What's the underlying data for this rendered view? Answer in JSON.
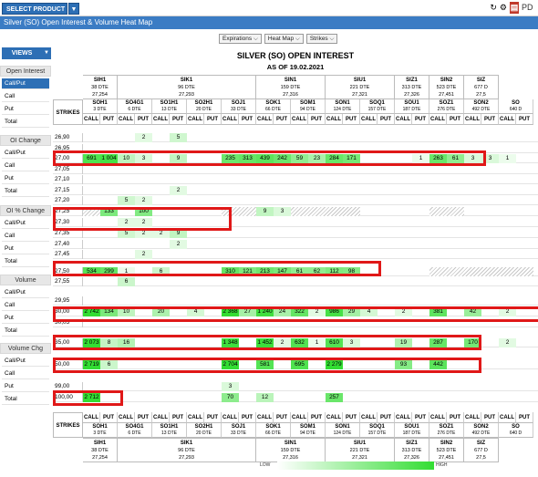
{
  "topbar": {
    "select_product": "SELECT PRODUCT",
    "pdf_label": "PD"
  },
  "title": "Silver (SO) Open Interest & Volume Heat Map",
  "controls": [
    "Expirations ⌵",
    "Heat Map ⌵",
    "Strikes ⌵"
  ],
  "sidebar": {
    "views": "VIEWS",
    "groups": [
      {
        "header": "Open Interest",
        "items": [
          "Call/Put",
          "Call",
          "Put",
          "Total"
        ],
        "selected": 0
      },
      {
        "header": "OI Change",
        "items": [
          "Call/Put",
          "Call",
          "Put",
          "Total"
        ]
      },
      {
        "header": "OI % Change",
        "items": [
          "Call/Put",
          "Call",
          "Put",
          "Total"
        ]
      },
      {
        "header": "Volume",
        "items": [
          "Call/Put",
          "Call",
          "Put",
          "Total"
        ]
      },
      {
        "header": "Volume Chg",
        "items": [
          "Call/Put",
          "Call",
          "Put",
          "Total"
        ]
      }
    ]
  },
  "heatmap": {
    "title": "SILVER (SO) OPEN INTEREST",
    "date": "AS OF 19.02.2021",
    "strikes_label": "STRIKES",
    "call": "CALL",
    "put": "PUT",
    "futures": [
      {
        "name": "SIH1",
        "dte": "38 DTE",
        "oi": "27,254"
      },
      {
        "name": "SIK1",
        "dte": "96 DTE",
        "oi": "27,293"
      },
      {
        "name": "SIN1",
        "dte": "159 DTE",
        "oi": "27,316"
      },
      {
        "name": "SIU1",
        "dte": "221 DTE",
        "oi": "27,321"
      },
      {
        "name": "SIZ1",
        "dte": "313 DTE",
        "oi": "27,326"
      },
      {
        "name": "SIN2",
        "dte": "523 DTE",
        "oi": "27,451"
      },
      {
        "name": "SIZ",
        "dte": "677 D",
        "oi": "27,5"
      }
    ],
    "options": [
      {
        "name": "SOH1",
        "dte": "3 DTE"
      },
      {
        "name": "SO4G1",
        "dte": "6 DTE"
      },
      {
        "name": "SO1H1",
        "dte": "13 DTE"
      },
      {
        "name": "SO2H1",
        "dte": "20 DTE"
      },
      {
        "name": "SOJ1",
        "dte": "33 DTE"
      },
      {
        "name": "SOK1",
        "dte": "66 DTE"
      },
      {
        "name": "SOM1",
        "dte": "94 DTE"
      },
      {
        "name": "SON1",
        "dte": "124 DTE"
      },
      {
        "name": "SOQ1",
        "dte": "157 DTE"
      },
      {
        "name": "SOU1",
        "dte": "187 DTE"
      },
      {
        "name": "SOZ1",
        "dte": "276 DTE"
      },
      {
        "name": "SON2",
        "dte": "492 DTE"
      },
      {
        "name": "SO",
        "dte": "640 D"
      }
    ],
    "rows": [
      {
        "strike": "26,90",
        "cells": [
          "",
          "",
          "",
          "2",
          "",
          "5",
          "",
          "",
          "",
          "",
          "",
          "",
          "",
          "",
          "",
          "",
          "",
          "",
          "",
          "",
          "",
          "",
          "",
          "",
          "",
          ""
        ]
      },
      {
        "strike": "26,95",
        "cells": []
      },
      {
        "strike": "27,00",
        "cells": [
          "691",
          "1 004",
          "10",
          "3",
          "",
          "9",
          "",
          "",
          "235",
          "313",
          "439",
          "242",
          "59",
          "23",
          "284",
          "171",
          "",
          "",
          "",
          "1",
          "263",
          "61",
          "3",
          "3",
          "1",
          ""
        ]
      },
      {
        "strike": "27,05",
        "cells": []
      },
      {
        "strike": "27,10",
        "cells": []
      },
      {
        "strike": "27,15",
        "cells": [
          "",
          "",
          "",
          "",
          "",
          "2",
          "",
          "",
          "",
          "",
          "",
          "",
          "",
          "",
          "",
          "",
          "",
          "",
          "",
          "",
          "",
          "",
          "",
          "",
          "",
          ""
        ]
      },
      {
        "strike": "27,20",
        "cells": [
          "",
          "",
          "5",
          "2",
          "",
          "",
          "",
          "",
          "",
          "",
          "",
          "",
          "",
          "",
          "",
          "",
          "",
          "",
          "",
          "",
          "",
          "",
          "",
          "",
          "",
          ""
        ]
      },
      {
        "strike": "27,25",
        "cells": [
          "234",
          "133",
          "",
          "100",
          "",
          "",
          "",
          "",
          "415",
          "38",
          "9",
          "3",
          "41",
          "41",
          "2",
          "2",
          "",
          "",
          "",
          "",
          "1",
          "1",
          "",
          "",
          "",
          ""
        ]
      },
      {
        "strike": "27,30",
        "cells": [
          "",
          "",
          "2",
          "2",
          "",
          "",
          "",
          "",
          "",
          "",
          "",
          "",
          "",
          "",
          "",
          "",
          "",
          "",
          "",
          "",
          "",
          "",
          "",
          "",
          "",
          ""
        ]
      },
      {
        "strike": "27,35",
        "cells": [
          "",
          "",
          "5",
          "2",
          "2",
          "9",
          "",
          "",
          "",
          "",
          "",
          "",
          "",
          "",
          "",
          "",
          "",
          "",
          "",
          "",
          "",
          "",
          "",
          "",
          "",
          ""
        ]
      },
      {
        "strike": "27,40",
        "cells": [
          "",
          "",
          "",
          "",
          "",
          "2",
          "",
          "",
          "",
          "",
          "",
          "",
          "",
          "",
          "",
          "",
          "",
          "",
          "",
          "",
          "",
          "",
          "",
          "",
          "",
          ""
        ]
      },
      {
        "strike": "27,45",
        "cells": [
          "",
          "",
          "",
          "2",
          "",
          "",
          "",
          "",
          "",
          "",
          "",
          "",
          "",
          "",
          "",
          "",
          "",
          "",
          "",
          "",
          "",
          "",
          "",
          "",
          "",
          ""
        ]
      },
      {
        "strike": "27,50",
        "cells": [
          "534",
          "299",
          "1",
          "",
          "6",
          "",
          "",
          "",
          "310",
          "121",
          "213",
          "147",
          "61",
          "62",
          "112",
          "98",
          "",
          "",
          "",
          "",
          "10",
          "",
          "",
          "",
          "",
          ""
        ]
      },
      {
        "strike": "27,55",
        "cells": [
          "",
          "",
          "6",
          "",
          "",
          "",
          "",
          "",
          "",
          "",
          "",
          "",
          "",
          "",
          "",
          "",
          "",
          "",
          "",
          "",
          "",
          "",
          "",
          "",
          "",
          ""
        ]
      },
      {
        "strike": "29,95",
        "cells": []
      },
      {
        "strike": "30,00",
        "cells": [
          "2 742",
          "134",
          "10",
          "",
          "20",
          "",
          "4",
          "",
          "2 368",
          "27",
          "1 240",
          "24",
          "322",
          "2",
          "986",
          "29",
          "4",
          "",
          "2",
          "",
          "381",
          "",
          "42",
          "",
          "2",
          ""
        ]
      },
      {
        "strike": "30,05",
        "cells": []
      },
      {
        "strike": "35,00",
        "cells": [
          "2 073",
          "8",
          "16",
          "",
          "",
          "",
          "",
          "",
          "1 348",
          "",
          "1 452",
          "2",
          "632",
          "1",
          "610",
          "3",
          "",
          "",
          "19",
          "",
          "287",
          "",
          "170",
          "",
          "2",
          ""
        ]
      },
      {
        "strike": "50,00",
        "cells": [
          "2 719",
          "6",
          "",
          "",
          "",
          "",
          "",
          "",
          "2 704",
          "",
          "581",
          "",
          "695",
          "",
          "2 279",
          "",
          "",
          "",
          "93",
          "",
          "442",
          "",
          "",
          "",
          "",
          ""
        ]
      },
      {
        "strike": "99,00",
        "cells": [
          "",
          "",
          "",
          "",
          "",
          "",
          "",
          "",
          "3",
          "",
          "",
          "",
          "",
          "",
          "",
          "",
          "",
          "",
          "",
          "",
          "",
          "",
          "",
          "",
          "",
          ""
        ]
      },
      {
        "strike": "100,00",
        "cells": [
          "2 712",
          "",
          "",
          "",
          "",
          "",
          "",
          "",
          "70",
          "",
          "12",
          "",
          "",
          "",
          "257",
          "",
          "",
          "",
          "",
          "",
          "",
          "",
          "",
          "",
          "",
          ""
        ]
      }
    ],
    "legend_low": "LOW",
    "legend_high": "HIGH"
  }
}
